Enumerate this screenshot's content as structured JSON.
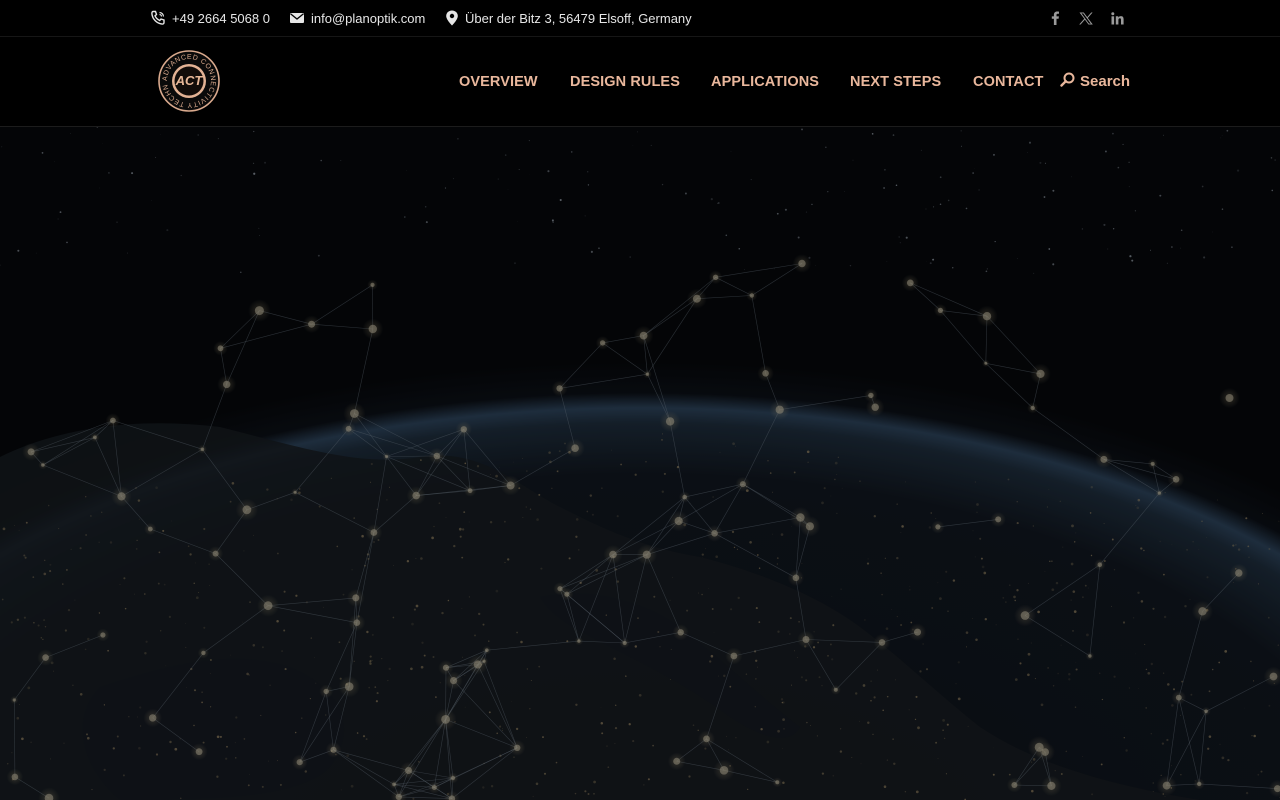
{
  "topbar": {
    "phone": "+49 2664 5068 0",
    "email": "info@planoptik.com",
    "address": "Über der Bitz 3, 56479 Elsoff, Germany",
    "socials": [
      {
        "icon": "facebook-icon",
        "label": "f"
      },
      {
        "icon": "x-twitter-icon",
        "label": "X"
      },
      {
        "icon": "linkedin-icon",
        "label": "in"
      }
    ]
  },
  "logo": {
    "text": "ACT",
    "ring_text": "ADVANCED CONNECTIVITY TECHNOLOGY"
  },
  "nav": {
    "items": [
      "OVERVIEW",
      "DESIGN RULES",
      "APPLICATIONS",
      "NEXT STEPS",
      "CONTACT"
    ],
    "search_label": "Search"
  },
  "colors": {
    "accent": "#e9b79c",
    "background": "#000000",
    "topbar_text": "#e6e6e6"
  }
}
